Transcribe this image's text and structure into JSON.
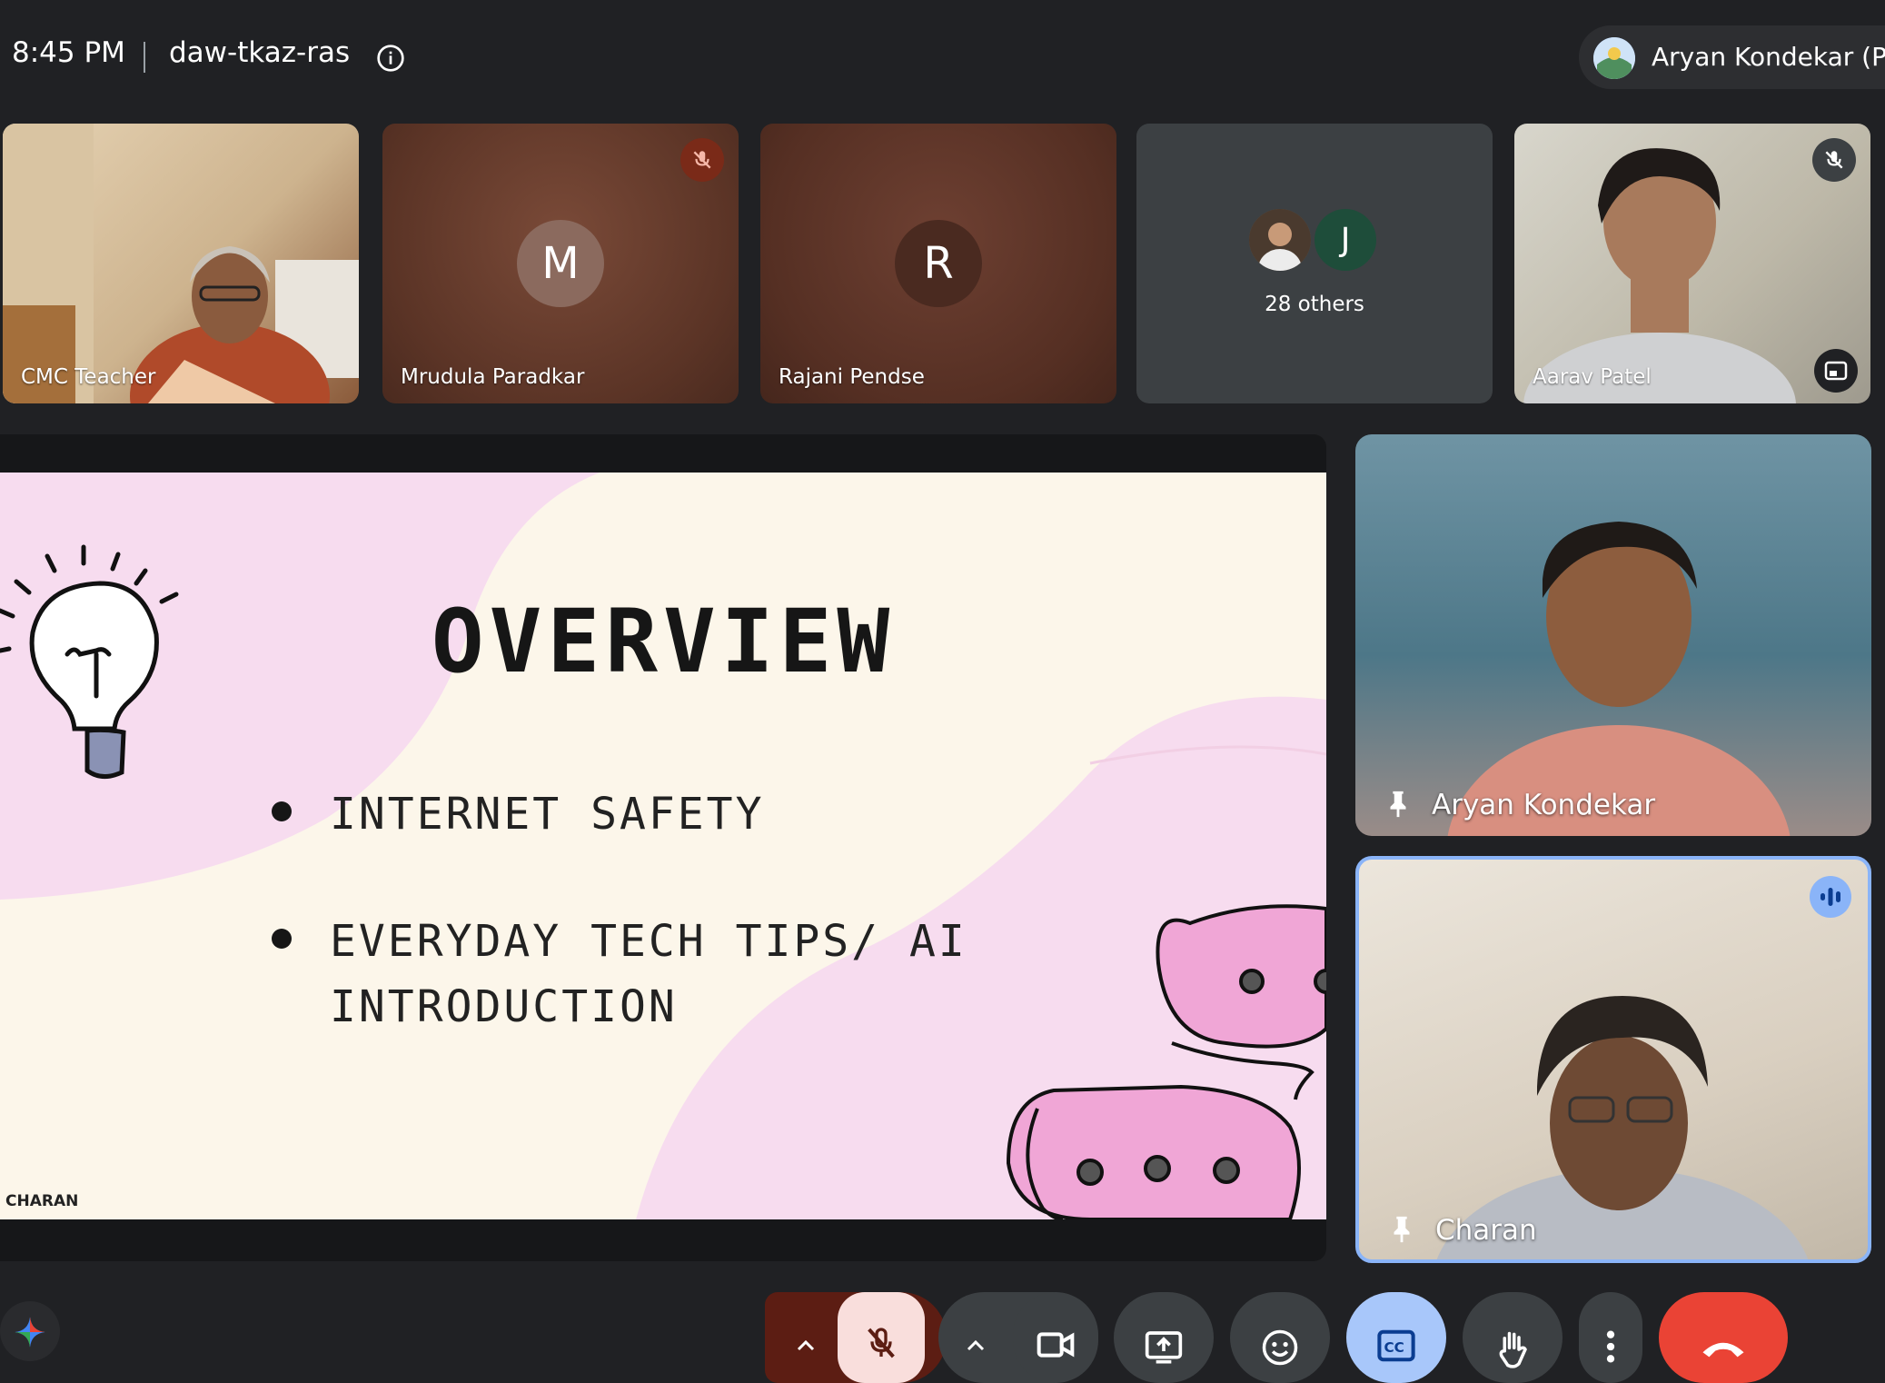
{
  "topbar": {
    "time": "8:45 PM",
    "meeting_code": "daw-tkaz-ras",
    "presenter_label": "Aryan Kondekar (Pre"
  },
  "tiles": [
    {
      "name": "CMC Teacher"
    },
    {
      "name": "Mrudula Paradkar",
      "initial": "M"
    },
    {
      "name": "Rajani Pendse",
      "initial": "R"
    },
    {
      "others_label": "28 others",
      "initial": "J"
    },
    {
      "name": "Aarav Patel"
    }
  ],
  "slide": {
    "title": "OVERVIEW",
    "bullets": [
      "INTERNET SAFETY",
      "EVERYDAY TECH TIPS/ AI",
      "INTRODUCTION"
    ],
    "footer": "CHARAN"
  },
  "side": {
    "speaker1": "Aryan Kondekar",
    "speaker2": "Charan"
  },
  "colors": {
    "accent": "#8ab4f8",
    "end_call": "#ea4335",
    "mic_muted_bg": "#f9dedc"
  },
  "icons": [
    "info-icon",
    "mic-off-icon",
    "pin-icon",
    "audio-level-icon",
    "camera-icon",
    "present-icon",
    "emoji-icon",
    "captions-icon",
    "raise-hand-icon",
    "more-icon",
    "end-call-icon",
    "gemini-icon",
    "expand-icon"
  ]
}
